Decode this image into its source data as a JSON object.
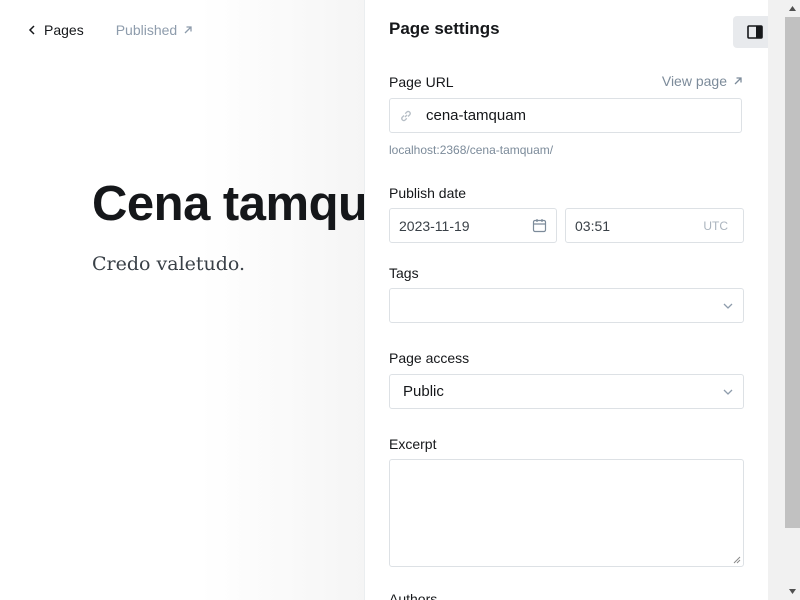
{
  "nav": {
    "back_label": "Pages",
    "status_label": "Published"
  },
  "post": {
    "title": "Cena tamquam",
    "body": "Credo valetudo."
  },
  "settings": {
    "title": "Page settings",
    "url_label": "Page URL",
    "view_page_label": "View page",
    "slug_value": "cena-tamquam",
    "url_hint": "localhost:2368/cena-tamquam/",
    "publish_date_label": "Publish date",
    "date_value": "2023-11-19",
    "time_value": "03:51",
    "timezone": "UTC",
    "tags_label": "Tags",
    "tags_value": "",
    "access_label": "Page access",
    "access_value": "Public",
    "excerpt_label": "Excerpt",
    "excerpt_value": "",
    "authors_label": "Authors"
  },
  "icons": {
    "back": "chevron-left-icon",
    "external": "arrow-up-right-icon",
    "link": "link-icon",
    "calendar": "calendar-icon",
    "dropdown": "chevron-down-icon",
    "sidebar_toggle": "sidebar-toggle-icon"
  },
  "colors": {
    "text": "#15171a",
    "muted": "#8e9cac",
    "border": "#dde1e5",
    "toggle_bg": "#e8eaed"
  }
}
